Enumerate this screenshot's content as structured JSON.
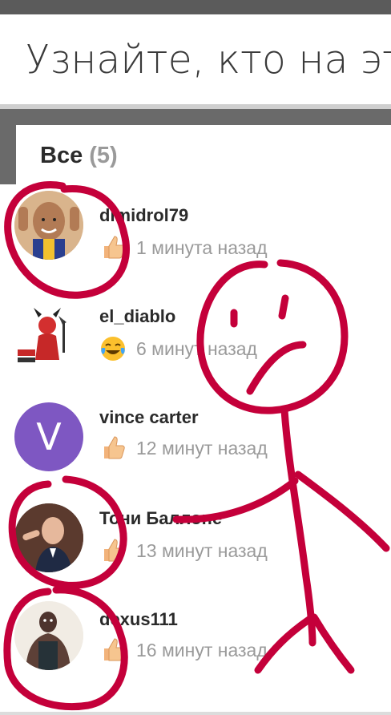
{
  "header": {
    "title": "Узнайте, кто на это"
  },
  "section": {
    "label": "Все",
    "count": "(5)"
  },
  "reactions": [
    {
      "username": "dimidrol79",
      "reaction": "thumbs-up",
      "time": "1 минута назад",
      "avatar": "player-photo"
    },
    {
      "username": "el_diablo",
      "reaction": "tears-of-joy",
      "time": "6 минут назад",
      "avatar": "devil-logo"
    },
    {
      "username": "vince carter",
      "reaction": "thumbs-up",
      "time": "12 минут назад",
      "avatar": "letter-avatar",
      "avatar_letter": "V",
      "avatar_color": "#7e57c2"
    },
    {
      "username": "Тони Баллоне",
      "reaction": "thumbs-up",
      "time": "13 минут назад",
      "avatar": "coach-photo"
    },
    {
      "username": "dexus111",
      "reaction": "thumbs-up",
      "time": "16 минут назад",
      "avatar": "cartoon-avatar"
    }
  ],
  "colors": {
    "doodle": "#c4003a",
    "accent_avatar": "#7e57c2",
    "muted_text": "#9a9a9a"
  }
}
